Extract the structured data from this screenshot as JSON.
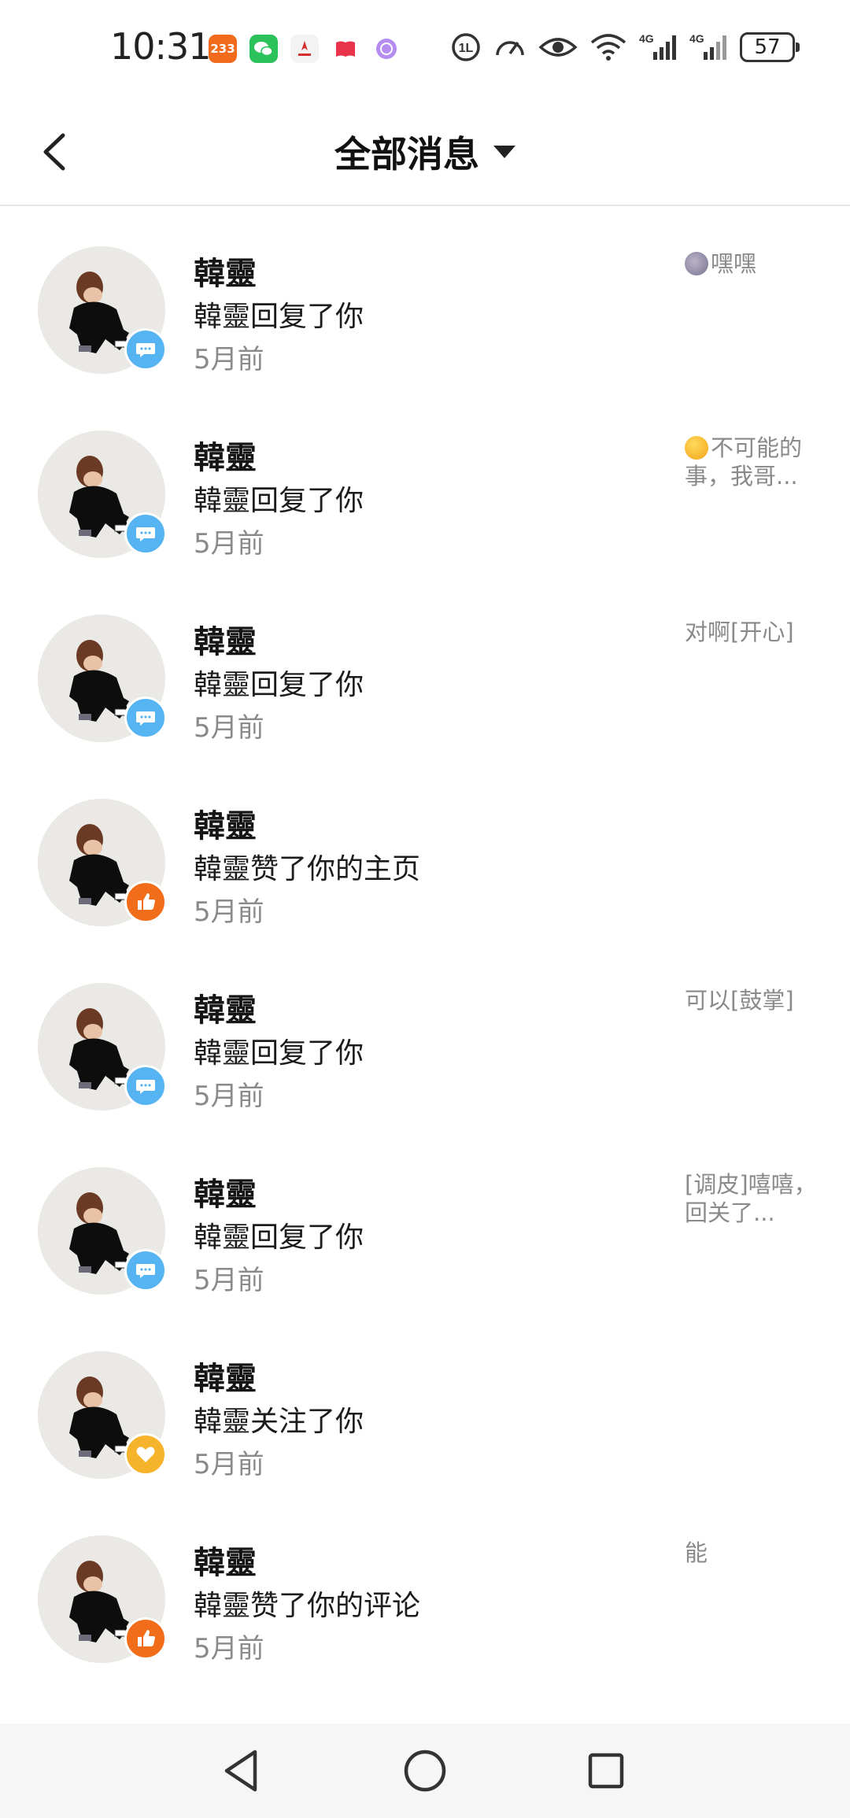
{
  "status_bar": {
    "time": "10:31",
    "app_icons": [
      {
        "name": "233-app-icon",
        "color": "#f26a1b",
        "label": "233"
      },
      {
        "name": "wechat-icon",
        "color": "#2bc15b"
      },
      {
        "name": "huawei-icon",
        "color": "#f3f3f3"
      },
      {
        "name": "book-app-icon",
        "color": "#e8334a"
      },
      {
        "name": "browser-app-icon",
        "color": "#b58cf0"
      }
    ],
    "battery": "57"
  },
  "header": {
    "title": "全部消息"
  },
  "messages": [
    {
      "name": "",
      "action": "",
      "time": "5月前",
      "preview": "",
      "badge": "like"
    },
    {
      "name": "韓靈",
      "action": "韓靈回复了你",
      "time": "5月前",
      "preview": "嘿嘿",
      "emoji": "moon",
      "badge": "reply"
    },
    {
      "name": "韓靈",
      "action": "韓靈回复了你",
      "time": "5月前",
      "preview": "不可能的事，我哥...",
      "emoji": "grin",
      "badge": "reply"
    },
    {
      "name": "韓靈",
      "action": "韓靈回复了你",
      "time": "5月前",
      "preview": "对啊[开心]",
      "badge": "reply"
    },
    {
      "name": "韓靈",
      "action": "韓靈赞了你的主页",
      "time": "5月前",
      "preview": "",
      "badge": "like"
    },
    {
      "name": "韓靈",
      "action": "韓靈回复了你",
      "time": "5月前",
      "preview": "可以[鼓掌]",
      "badge": "reply"
    },
    {
      "name": "韓靈",
      "action": "韓靈回复了你",
      "time": "5月前",
      "preview": "[调皮]嘻嘻，回关了...",
      "badge": "reply"
    },
    {
      "name": "韓靈",
      "action": "韓靈关注了你",
      "time": "5月前",
      "preview": "",
      "badge": "follow"
    },
    {
      "name": "韓靈",
      "action": "韓靈赞了你的评论",
      "time": "5月前",
      "preview": "能",
      "badge": "like"
    }
  ]
}
